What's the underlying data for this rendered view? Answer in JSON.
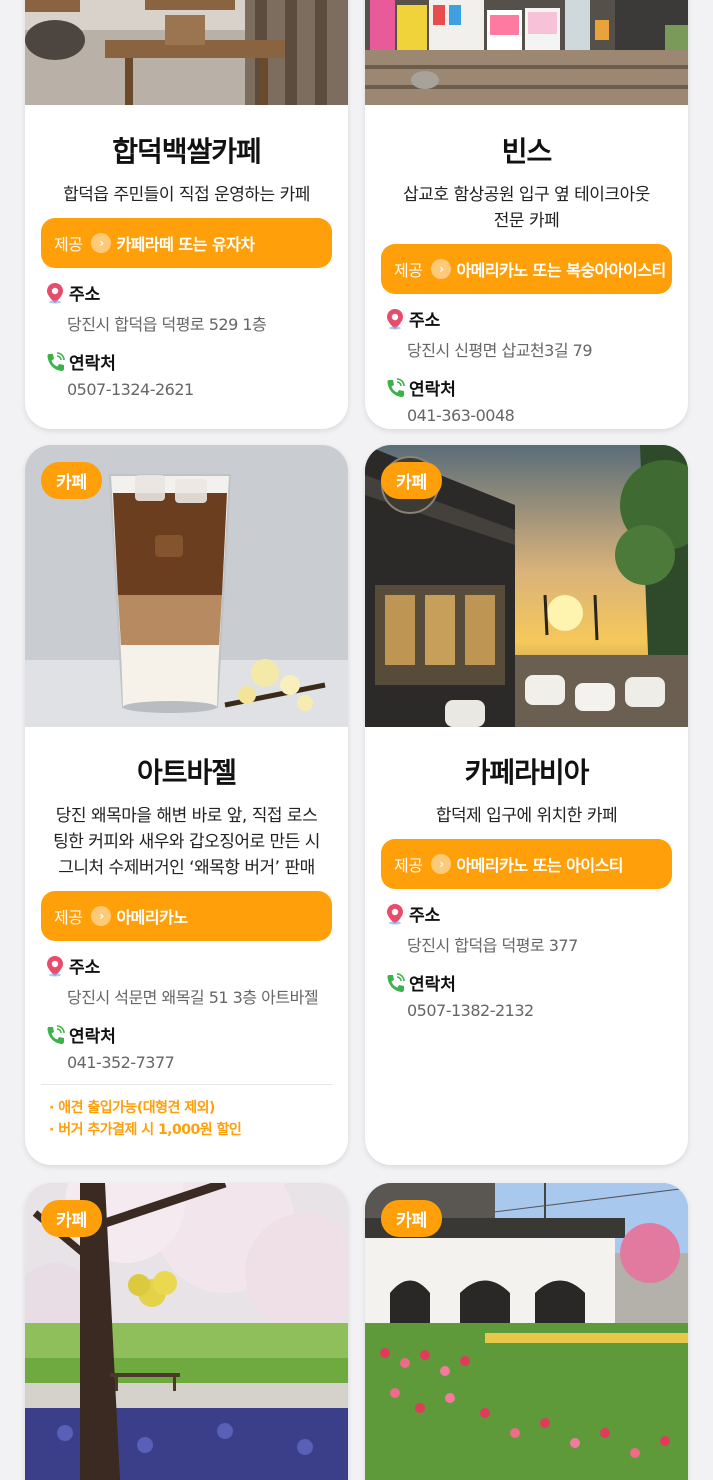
{
  "cards": [
    {
      "name": "합덕백쌀카페",
      "desc": "합덕읍 주민들이 직접 운영하는 카페",
      "offer_prefix": "제공",
      "offer": "카페라떼 또는 유자차",
      "address_label": "주소",
      "address": "당진시 합덕읍 덕평로 529 1층",
      "contact_label": "연락처",
      "phone": "0507-1324-2621"
    },
    {
      "name": "빈스",
      "desc": "삽교호 함상공원 입구 옆 테이크아웃 전문 카페",
      "offer_prefix": "제공",
      "offer": "아메리카노 또는 복숭아아이스티",
      "address_label": "주소",
      "address": "당진시 신평면 삽교천3길 79",
      "contact_label": "연락처",
      "phone": "041-363-0048"
    },
    {
      "tag": "카페",
      "name": "아트바젤",
      "desc": "당진 왜목마을 해변 바로 앞, 직접 로스팅한 커피와 새우와 갑오징어로 만든 시그니처 수제버거인 ‘왜목항 버거’ 판매",
      "offer_prefix": "제공",
      "offer": "아메리카노",
      "address_label": "주소",
      "address": "당진시 석문면 왜목길 51 3층 아트바젤",
      "contact_label": "연락처",
      "phone": "041-352-7377",
      "notes": [
        "· 애견 출입가능(대형견 제외)",
        "· 버거 추가결제 시 1,000원 할인"
      ]
    },
    {
      "tag": "카페",
      "name": "카페라비아",
      "desc": "합덕제 입구에 위치한 카페",
      "offer_prefix": "제공",
      "offer": "아메리카노 또는 아이스티",
      "address_label": "주소",
      "address": "당진시 합덕읍 덕평로 377",
      "contact_label": "연락처",
      "phone": "0507-1382-2132"
    },
    {
      "tag": "카페"
    },
    {
      "tag": "카페"
    }
  ],
  "colors": {
    "accent": "#ff9f0a",
    "background": "#f2f2f4"
  },
  "icons": {
    "address": "map-pin-icon",
    "contact": "phone-icon",
    "offer": "chevron-right-icon"
  }
}
